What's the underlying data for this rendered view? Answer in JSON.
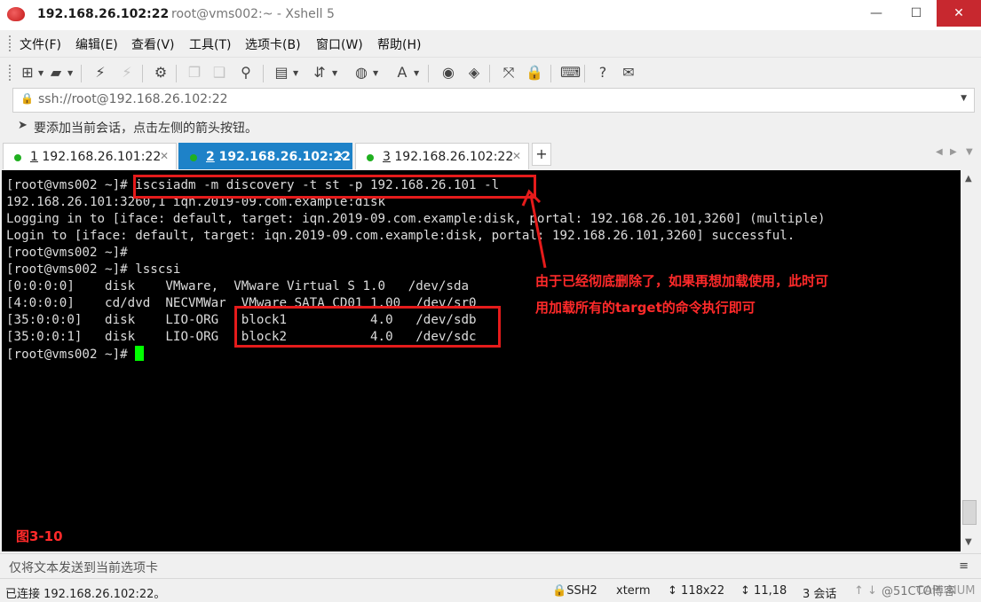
{
  "window": {
    "title_host": "192.168.26.102:22",
    "title_rest": "root@vms002:~ - Xshell 5",
    "minimize": "—",
    "maximize": "☐",
    "close": "✕"
  },
  "menu": [
    "文件(F)",
    "编辑(E)",
    "查看(V)",
    "工具(T)",
    "选项卡(B)",
    "窗口(W)",
    "帮助(H)"
  ],
  "address": {
    "lock": "🔒",
    "url": "ssh://root@192.168.26.102:22"
  },
  "hint": {
    "icon": "➤",
    "text": "要添加当前会话，点击左侧的箭头按钮。"
  },
  "tabs": [
    {
      "num": "1",
      "label": "192.168.26.101:22",
      "active": false
    },
    {
      "num": "2",
      "label": "192.168.26.102:22",
      "active": true
    },
    {
      "num": "3",
      "label": "192.168.26.102:22",
      "active": false
    }
  ],
  "new_tab": "+",
  "terminal": {
    "lines": [
      "[root@vms002 ~]# iscsiadm -m discovery -t st -p 192.168.26.101 -l",
      "192.168.26.101:3260,1 iqn.2019-09.com.example:disk",
      "Logging in to [iface: default, target: iqn.2019-09.com.example:disk, portal: 192.168.26.101,3260] (multiple)",
      "Login to [iface: default, target: iqn.2019-09.com.example:disk, portal: 192.168.26.101,3260] successful.",
      "[root@vms002 ~]#",
      "[root@vms002 ~]# lsscsi",
      "[0:0:0:0]    disk    VMware,  VMware Virtual S 1.0   /dev/sda",
      "[4:0:0:0]    cd/dvd  NECVMWar  VMware SATA CD01 1.00  /dev/sr0",
      "[35:0:0:0]   disk    LIO-ORG   block1           4.0   /dev/sdb",
      "[35:0:0:1]   disk    LIO-ORG   block2           4.0   /dev/sdc",
      "[root@vms002 ~]# "
    ]
  },
  "annotation": {
    "line1": "由于已经彻底删除了，如果再想加载使用，此时可",
    "line2": "用加载所有的target的命令执行即可"
  },
  "figure_label": "图3-10",
  "send_bar": {
    "placeholder": "仅将文本发送到当前选项卡",
    "menu_icon": "≡"
  },
  "status": {
    "connected": "已连接 192.168.26.102:22。",
    "protocol": "SSH2",
    "term": "xterm",
    "size": "118x22",
    "pos": "11,18",
    "sessions": "3 会话",
    "cap": "CAP",
    "num": "NUM"
  },
  "watermark": "@51CTO博客",
  "colors": {
    "accent_tab": "#1e82c8",
    "highlight": "#e51b1b",
    "cursor": "#00ff00",
    "close_button": "#c7282f"
  }
}
